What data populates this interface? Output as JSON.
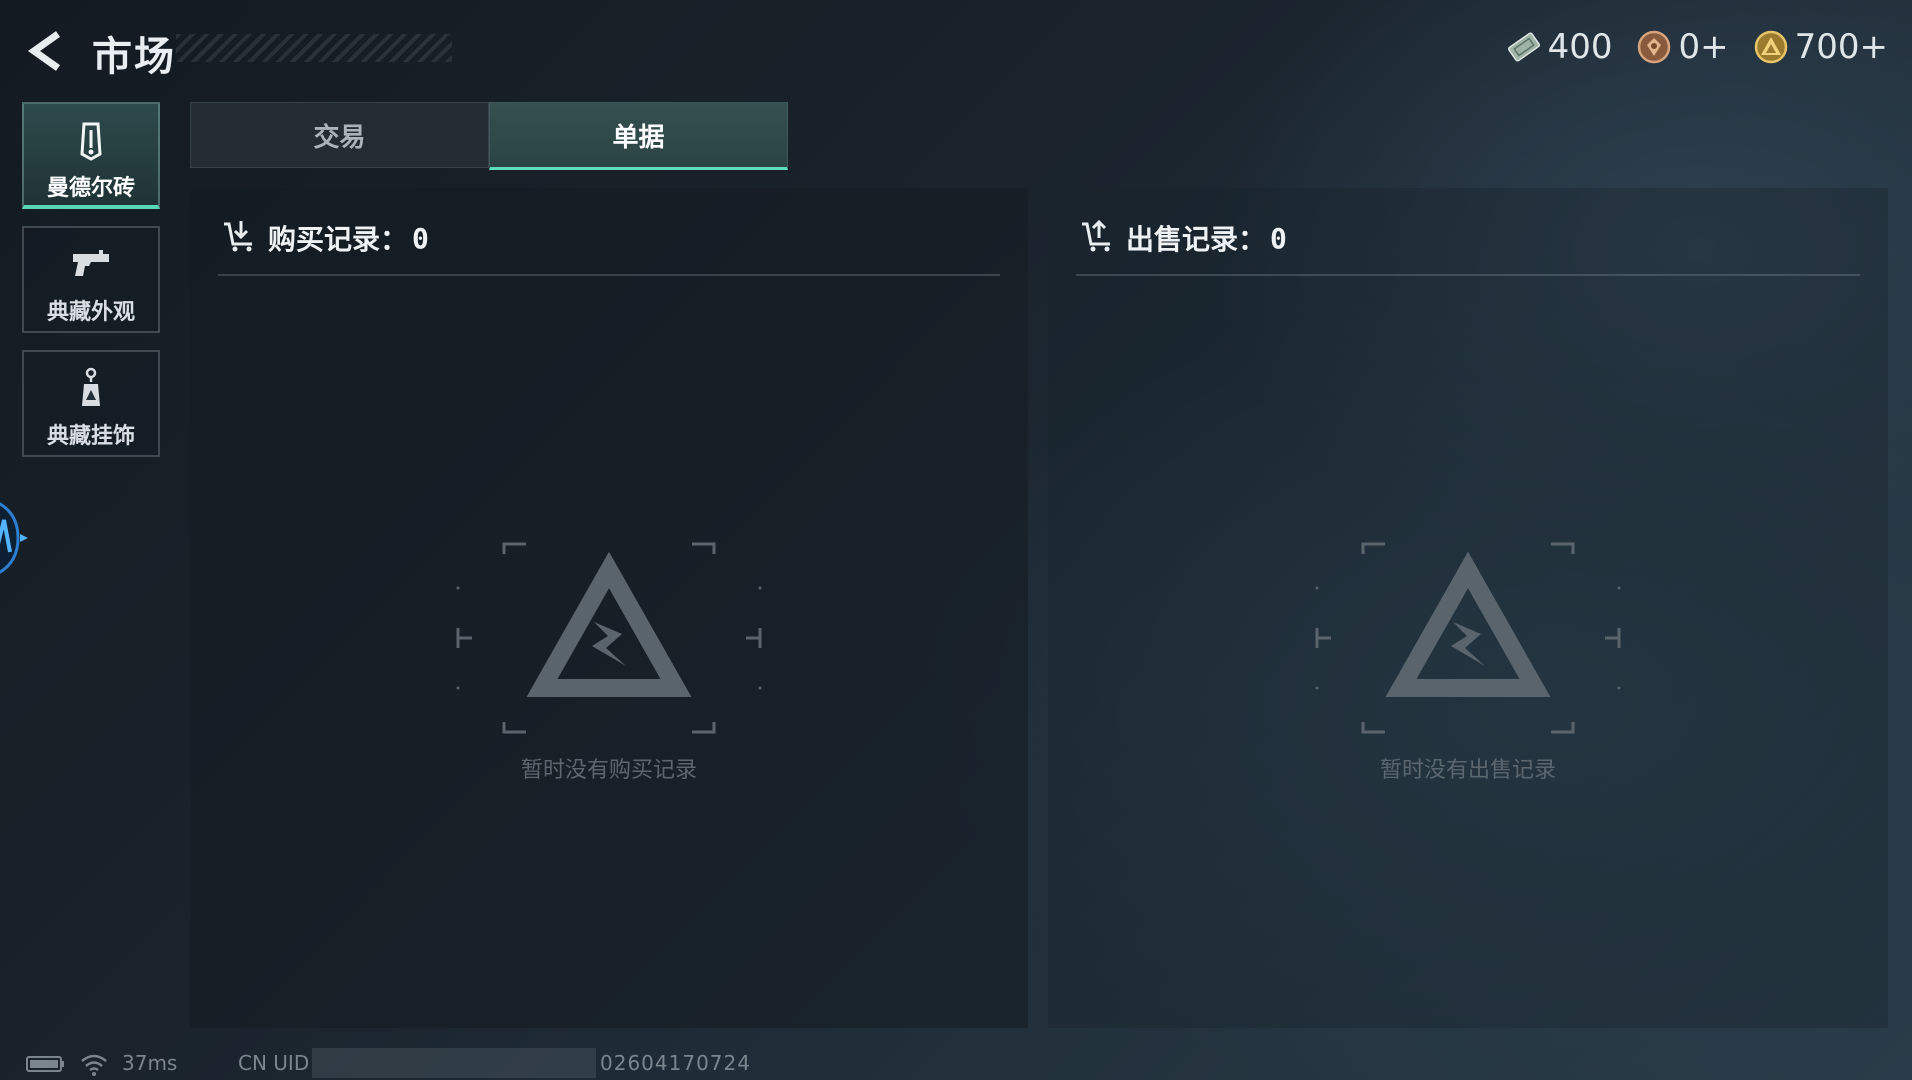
{
  "header": {
    "title": "市场",
    "back_icon": "chevron-left-icon"
  },
  "currencies": [
    {
      "icon": "ticket-icon",
      "value": "400"
    },
    {
      "icon": "bronze-coin-icon",
      "value": "0+"
    },
    {
      "icon": "gold-coin-icon",
      "value": "700+"
    }
  ],
  "sidebar": {
    "items": [
      {
        "label": "曼德尔砖",
        "icon": "mandel-brick-icon",
        "active": true
      },
      {
        "label": "典藏外观",
        "icon": "pistol-icon",
        "active": false
      },
      {
        "label": "典藏挂饰",
        "icon": "keychain-charm-icon",
        "active": false
      }
    ]
  },
  "tabs": [
    {
      "label": "交易",
      "active": false
    },
    {
      "label": "单据",
      "active": true
    }
  ],
  "purchase": {
    "label": "购买记录：",
    "count": "0",
    "empty_text": "暂时没有购买记录",
    "icon": "cart-download-icon"
  },
  "sale": {
    "label": "出售记录：",
    "count": "0",
    "empty_text": "暂时没有出售记录",
    "icon": "cart-upload-icon"
  },
  "status": {
    "ping": "37ms",
    "uid_label": "CN UID",
    "uid_value": "02604170724"
  },
  "colors": {
    "accent": "#5fdcbc",
    "background": "#1a232c"
  }
}
